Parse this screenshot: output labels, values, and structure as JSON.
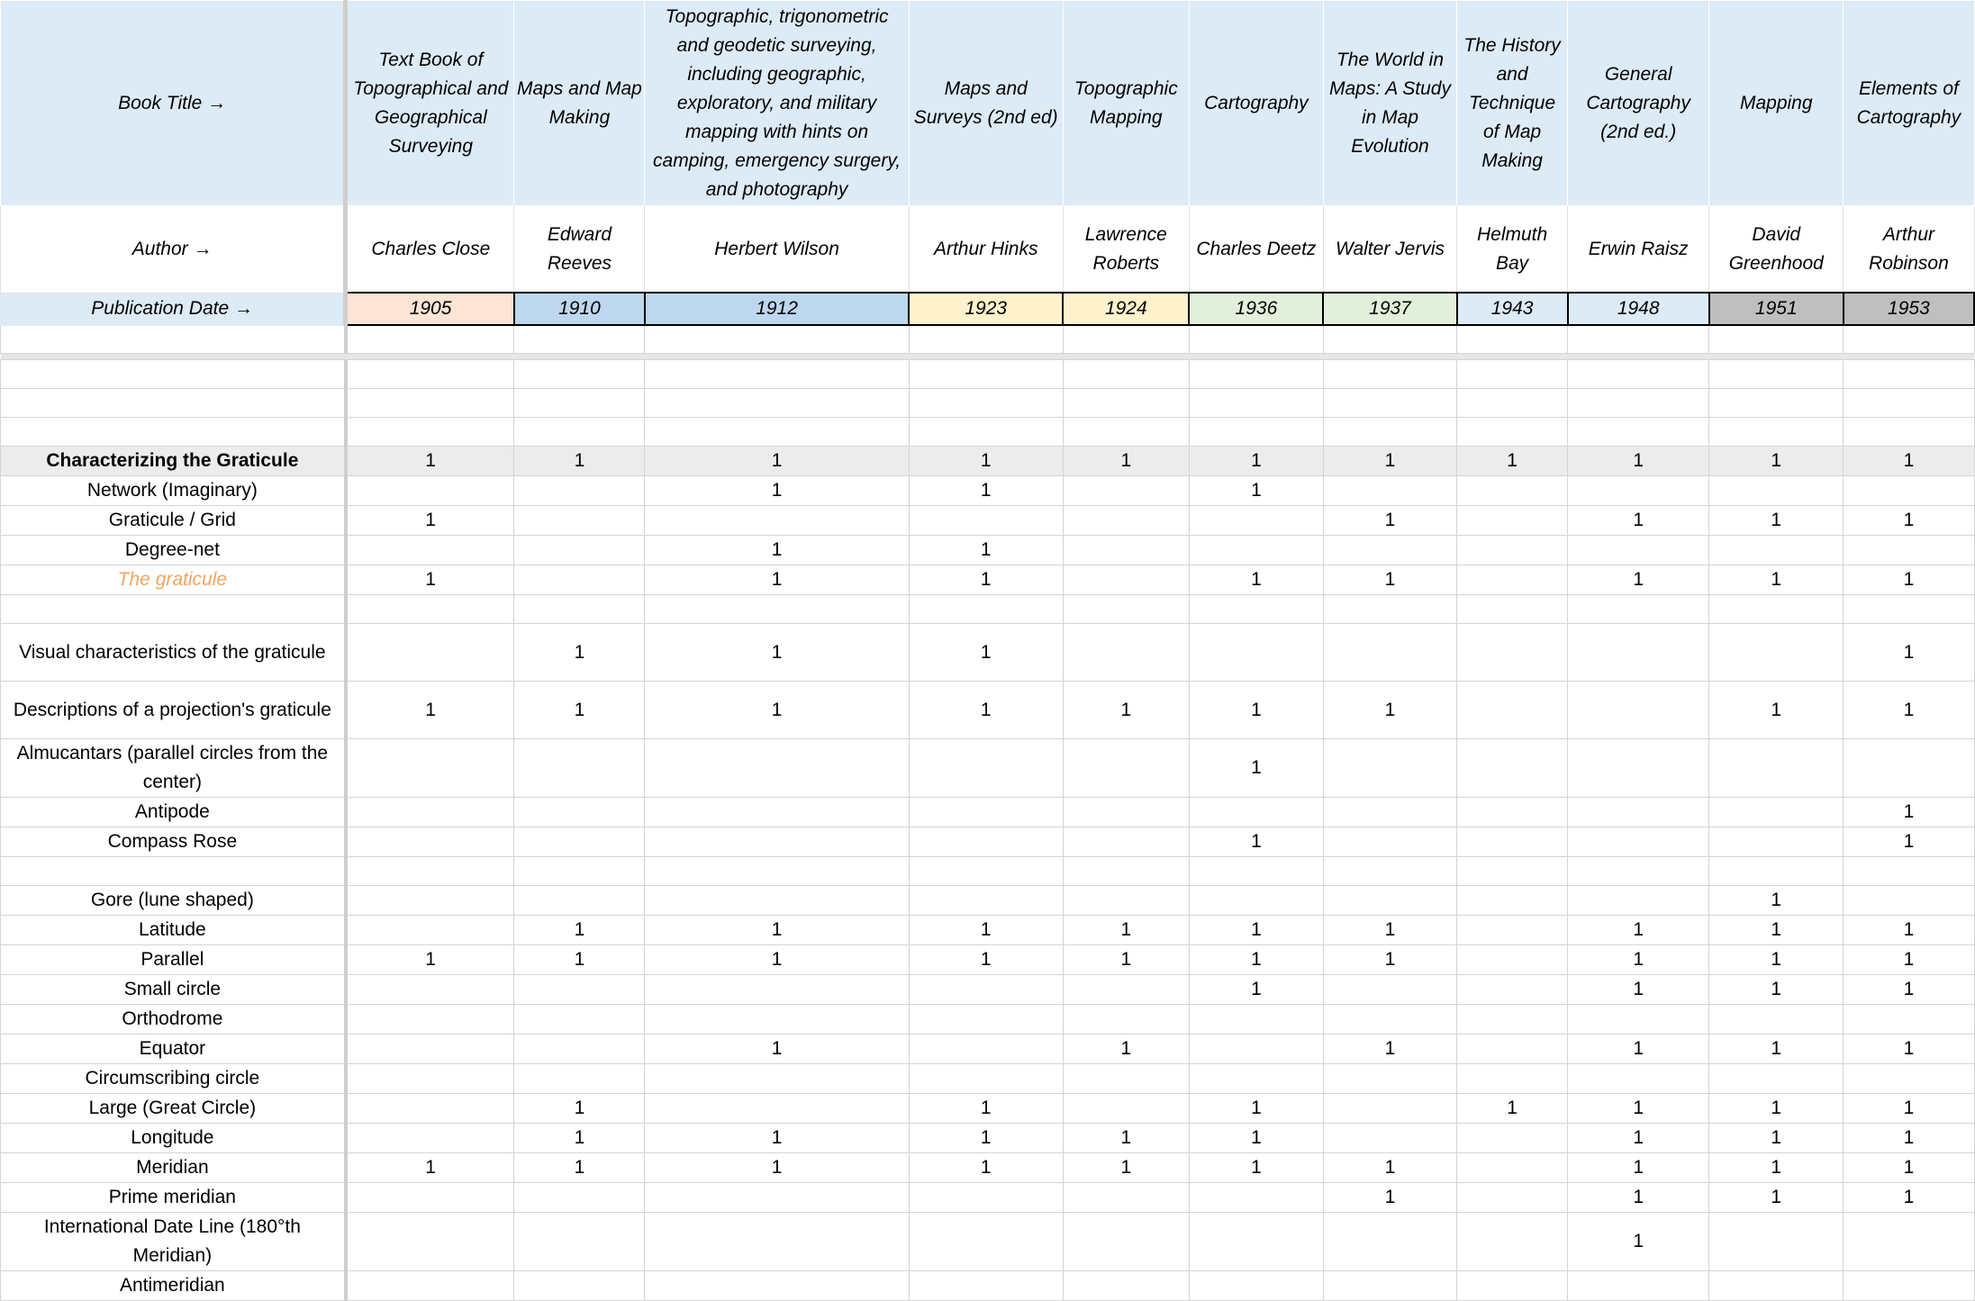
{
  "header": {
    "book_title_label": "Book Title →",
    "author_label": "Author →",
    "pub_date_label": "Publication Date →"
  },
  "books": [
    {
      "title": "Text Book of Topographical and Geographical Surveying",
      "author": "Charles Close",
      "date": "1905",
      "date_color": "#fce4d6"
    },
    {
      "title": "Maps and Map Making",
      "author": "Edward Reeves",
      "date": "1910",
      "date_color": "#bdd7ee"
    },
    {
      "title": "Topographic, trigonometric and geodetic surveying, including geographic, exploratory, and military mapping with hints on camping, emergency surgery, and photography",
      "author": "Herbert Wilson",
      "date": "1912",
      "date_color": "#bdd7ee"
    },
    {
      "title": "Maps and Surveys (2nd ed)",
      "author": "Arthur Hinks",
      "date": "1923",
      "date_color": "#fff2cc"
    },
    {
      "title": "Topographic Mapping",
      "author": "Lawrence Roberts",
      "date": "1924",
      "date_color": "#fff2cc"
    },
    {
      "title": "Cartography",
      "author": "Charles Deetz",
      "date": "1936",
      "date_color": "#e2efda"
    },
    {
      "title": "The World in Maps: A Study in Map Evolution",
      "author": "Walter Jervis",
      "date": "1937",
      "date_color": "#e2efda"
    },
    {
      "title": "The History and Technique of Map Making",
      "author": "Helmuth Bay",
      "date": "1943",
      "date_color": "#ddebf7"
    },
    {
      "title": "General Cartography (2nd ed.)",
      "author": "Erwin Raisz",
      "date": "1948",
      "date_color": "#ddebf7"
    },
    {
      "title": "Mapping",
      "author": "David Greenhood",
      "date": "1951",
      "date_color": "#bfbfbf"
    },
    {
      "title": "Elements of Cartography",
      "author": "Arthur Robinson",
      "date": "1953",
      "date_color": "#bfbfbf"
    }
  ],
  "rows": [
    {
      "label": "",
      "values": [
        "",
        "",
        "",
        "",
        "",
        "",
        "",
        "",
        "",
        "",
        ""
      ],
      "h": 1
    },
    {
      "label": "",
      "values": [
        "",
        "",
        "",
        "",
        "",
        "",
        "",
        "",
        "",
        "",
        ""
      ],
      "h": 1
    },
    {
      "label": "",
      "values": [
        "",
        "",
        "",
        "",
        "",
        "",
        "",
        "",
        "",
        "",
        ""
      ],
      "h": 1
    },
    {
      "label": "Characterizing the Graticule",
      "values": [
        "1",
        "1",
        "1",
        "1",
        "1",
        "1",
        "1",
        "1",
        "1",
        "1",
        "1"
      ],
      "h": 1,
      "style": "bold-highlight"
    },
    {
      "label": "Network (Imaginary)",
      "values": [
        "",
        "",
        "1",
        "1",
        "",
        "1",
        "",
        "",
        "",
        "",
        ""
      ],
      "h": 1
    },
    {
      "label": "Graticule / Grid",
      "values": [
        "1",
        "",
        "",
        "",
        "",
        "",
        "1",
        "",
        "1",
        "1",
        "1"
      ],
      "h": 1
    },
    {
      "label": "Degree-net",
      "values": [
        "",
        "",
        "1",
        "1",
        "",
        "",
        "",
        "",
        "",
        "",
        ""
      ],
      "h": 1
    },
    {
      "label": "The graticule",
      "values": [
        "1",
        "",
        "1",
        "1",
        "",
        "1",
        "1",
        "",
        "1",
        "1",
        "1"
      ],
      "h": 1,
      "style": "orange"
    },
    {
      "label": "",
      "values": [
        "",
        "",
        "",
        "",
        "",
        "",
        "",
        "",
        "",
        "",
        ""
      ],
      "h": 1
    },
    {
      "label": "Visual characteristics of the graticule",
      "values": [
        "",
        "1",
        "1",
        "1",
        "",
        "",
        "",
        "",
        "",
        "",
        "1"
      ],
      "h": 2
    },
    {
      "label": "Descriptions of a projection's graticule",
      "values": [
        "1",
        "1",
        "1",
        "1",
        "1",
        "1",
        "1",
        "",
        "",
        "1",
        "1"
      ],
      "h": 2
    },
    {
      "label": "Almucantars (parallel circles from the center)",
      "values": [
        "",
        "",
        "",
        "",
        "",
        "1",
        "",
        "",
        "",
        "",
        ""
      ],
      "h": 2
    },
    {
      "label": "Antipode",
      "values": [
        "",
        "",
        "",
        "",
        "",
        "",
        "",
        "",
        "",
        "",
        "1"
      ],
      "h": 1
    },
    {
      "label": "Compass Rose",
      "values": [
        "",
        "",
        "",
        "",
        "",
        "1",
        "",
        "",
        "",
        "",
        "1"
      ],
      "h": 1
    },
    {
      "label": "",
      "values": [
        "",
        "",
        "",
        "",
        "",
        "",
        "",
        "",
        "",
        "",
        ""
      ],
      "h": 1
    },
    {
      "label": "Gore (lune shaped)",
      "values": [
        "",
        "",
        "",
        "",
        "",
        "",
        "",
        "",
        "",
        "1",
        ""
      ],
      "h": 1
    },
    {
      "label": "Latitude",
      "values": [
        "",
        "1",
        "1",
        "1",
        "1",
        "1",
        "1",
        "",
        "1",
        "1",
        "1"
      ],
      "h": 1
    },
    {
      "label": "Parallel",
      "values": [
        "1",
        "1",
        "1",
        "1",
        "1",
        "1",
        "1",
        "",
        "1",
        "1",
        "1"
      ],
      "h": 1
    },
    {
      "label": "Small circle",
      "values": [
        "",
        "",
        "",
        "",
        "",
        "1",
        "",
        "",
        "1",
        "1",
        "1"
      ],
      "h": 1
    },
    {
      "label": "Orthodrome",
      "values": [
        "",
        "",
        "",
        "",
        "",
        "",
        "",
        "",
        "",
        "",
        ""
      ],
      "h": 1
    },
    {
      "label": "Equator",
      "values": [
        "",
        "",
        "1",
        "",
        "1",
        "",
        "1",
        "",
        "1",
        "1",
        "1"
      ],
      "h": 1
    },
    {
      "label": "Circumscribing circle",
      "values": [
        "",
        "",
        "",
        "",
        "",
        "",
        "",
        "",
        "",
        "",
        ""
      ],
      "h": 1
    },
    {
      "label": "Large (Great Circle)",
      "values": [
        "",
        "1",
        "",
        "1",
        "",
        "1",
        "",
        "1",
        "1",
        "1",
        "1"
      ],
      "h": 1
    },
    {
      "label": "Longitude",
      "values": [
        "",
        "1",
        "1",
        "1",
        "1",
        "1",
        "",
        "",
        "1",
        "1",
        "1"
      ],
      "h": 1
    },
    {
      "label": "Meridian",
      "values": [
        "1",
        "1",
        "1",
        "1",
        "1",
        "1",
        "1",
        "",
        "1",
        "1",
        "1"
      ],
      "h": 1
    },
    {
      "label": "Prime meridian",
      "values": [
        "",
        "",
        "",
        "",
        "",
        "",
        "1",
        "",
        "1",
        "1",
        "1"
      ],
      "h": 1
    },
    {
      "label": "International Date Line (180°th Meridian)",
      "values": [
        "",
        "",
        "",
        "",
        "",
        "",
        "",
        "",
        "1",
        "",
        ""
      ],
      "h": 2
    },
    {
      "label": "Antimeridian",
      "values": [
        "",
        "",
        "",
        "",
        "",
        "",
        "",
        "",
        "",
        "",
        ""
      ],
      "h": 1
    }
  ]
}
